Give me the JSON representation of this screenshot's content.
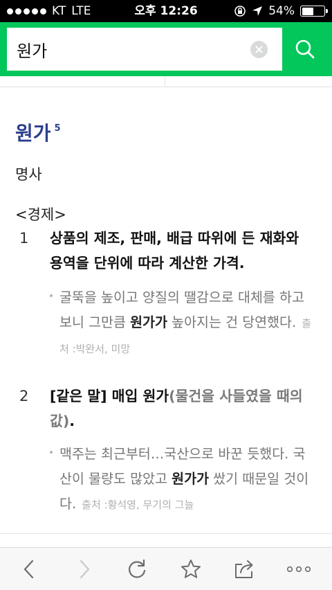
{
  "status_bar": {
    "carrier": "KT",
    "network": "LTE",
    "time": "오후 12:26",
    "battery": "54%",
    "battery_level": 0.54
  },
  "search": {
    "query": "원가"
  },
  "entry": {
    "headword": "원가",
    "homonym_number": "5",
    "part_of_speech": "명사",
    "field": "<경제>",
    "senses": [
      {
        "number": "1",
        "definition": "상품의 제조, 판매, 배급 따위에 든 재화와 용역을 단위에 따라 계산한 가격.",
        "example_before": "굴뚝을 높이고 양질의 땔감으로 대체를 하고 보니 그만큼 ",
        "example_keyword": "원가가",
        "example_after": " 높아지는 건 당연했다.",
        "source": "출처 :박완서, 미망"
      },
      {
        "number": "2",
        "definition_main": "[같은 말] 매입 원가",
        "definition_paren": "(물건을 사들였을 때의 값)",
        "definition_end": ".",
        "example_before": "맥주는 최근부터…국산으로 바꾼 듯했다. 국산이 물량도 많았고 ",
        "example_keyword": "원가가",
        "example_after": " 쌌기 때문일 것이다.",
        "source": "출처 :황석영, 무기의 그늘"
      }
    ]
  },
  "colors": {
    "brand_green": "#03c75a",
    "headword_blue": "#2b3f8c"
  },
  "toolbar": {
    "icons": [
      "back-icon",
      "forward-icon",
      "reload-icon",
      "bookmark-star-icon",
      "share-icon",
      "more-icon"
    ]
  }
}
